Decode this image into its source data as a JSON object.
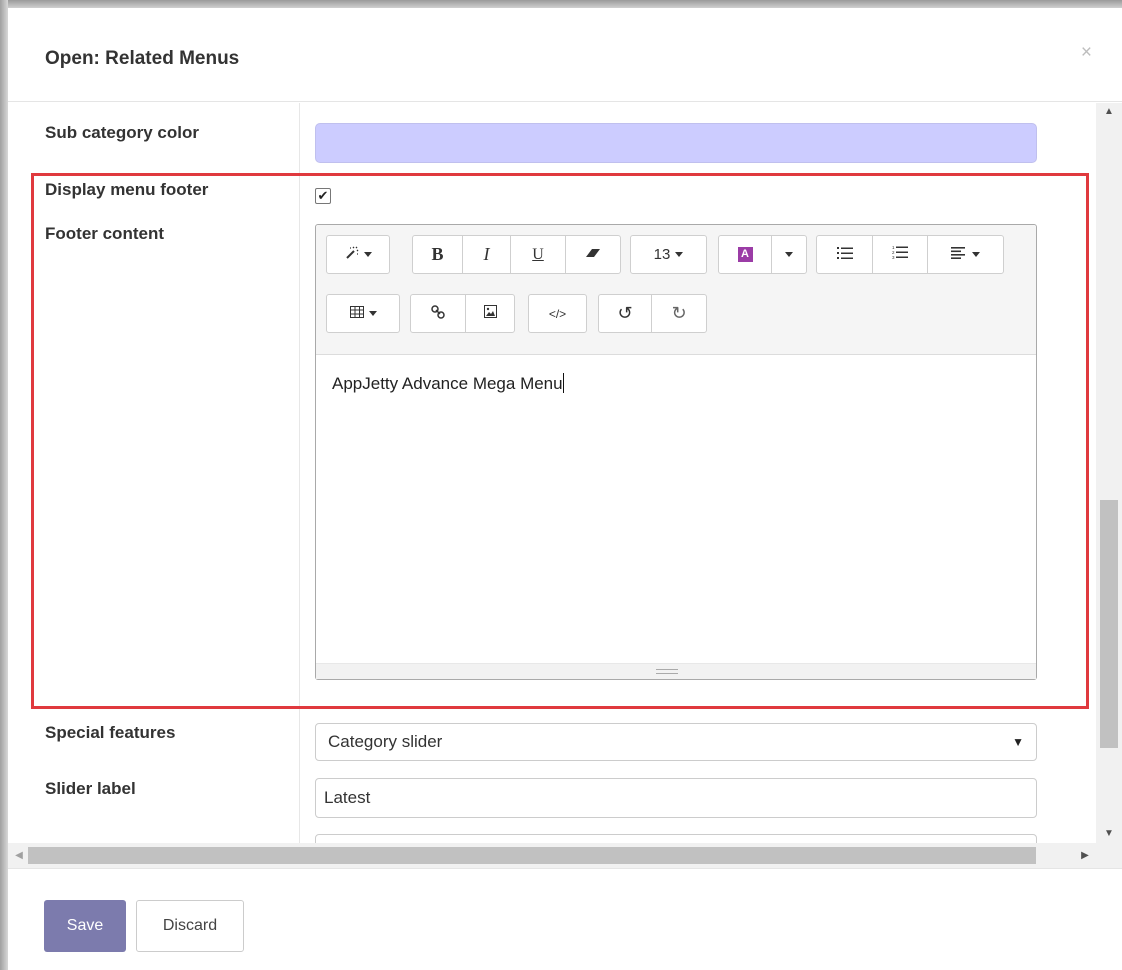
{
  "dialog": {
    "title": "Open: Related Menus",
    "close": "×"
  },
  "fields": {
    "sub_category_color": {
      "label": "Sub category color",
      "value_color": "#ccccff"
    },
    "display_menu_footer": {
      "label": "Display menu footer",
      "checked": true,
      "check_glyph": "✔"
    },
    "footer_content": {
      "label": "Footer content",
      "value": "AppJetty Advance Mega Menu"
    },
    "special_features": {
      "label": "Special features",
      "value": "Category slider"
    },
    "slider_label": {
      "label": "Slider label",
      "value": "Latest"
    }
  },
  "toolbar": {
    "font_size": "13",
    "bold": "B",
    "italic": "I",
    "underline": "U"
  },
  "icons": {
    "style": "magic-wand-icon",
    "eraser": "eraser-icon",
    "font_color": "font-color-icon",
    "unordered_list": "unordered-list-icon",
    "ordered_list": "ordered-list-icon",
    "align": "align-left-icon",
    "table": "table-icon",
    "link": "link-icon",
    "picture": "picture-icon",
    "codeview": "code-view-icon",
    "undo": "undo-icon",
    "redo": "redo-icon"
  },
  "footer": {
    "save": "Save",
    "discard": "Discard"
  },
  "colors": {
    "highlight_border": "#e0393e",
    "primary_button": "#7c7bad",
    "font_color_swatch": "#9b3ca6"
  }
}
